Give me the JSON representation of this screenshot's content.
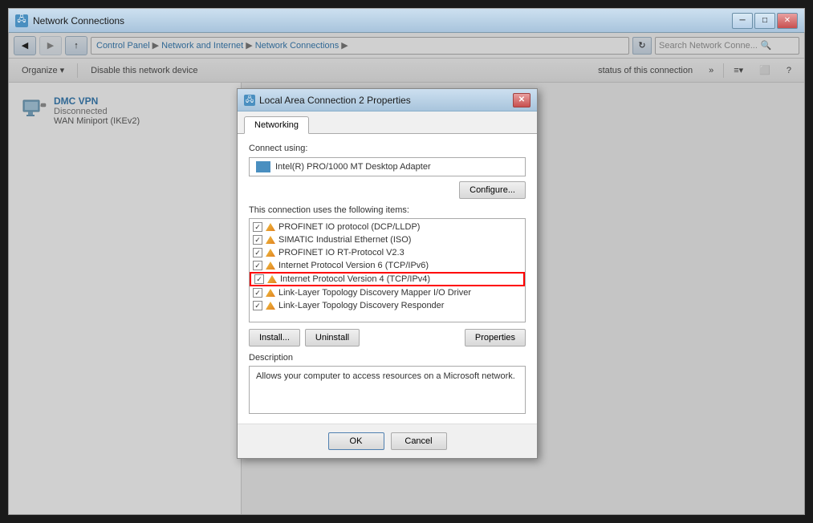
{
  "window": {
    "title": "Network Connections",
    "title_icon": "🖧"
  },
  "address_bar": {
    "crumbs": [
      "Control Panel",
      "Network and Internet",
      "Network Connections"
    ],
    "search_placeholder": "Search Network Conne...",
    "refresh_icon": "↻"
  },
  "toolbar": {
    "organize_label": "Organize",
    "disable_label": "Disable this network device",
    "status_label": "status of this connection",
    "more_label": "»"
  },
  "network_connections": [
    {
      "name": "DMC VPN",
      "status": "Disconnected",
      "type": "WAN Miniport (IKEv2)"
    }
  ],
  "title_bar_buttons": {
    "minimize": "─",
    "maximize": "□",
    "close": "✕"
  },
  "dialog": {
    "title": "Local Area Connection 2 Properties",
    "title_icon": "🖧",
    "tab_networking": "Networking",
    "connect_using_label": "Connect using:",
    "adapter_name": "Intel(R) PRO/1000 MT Desktop Adapter",
    "configure_btn": "Configure...",
    "items_label": "This connection uses the following items:",
    "items": [
      {
        "checked": true,
        "label": "PROFINET IO protocol (DCP/LLDP)"
      },
      {
        "checked": true,
        "label": "SIMATIC Industrial Ethernet (ISO)"
      },
      {
        "checked": true,
        "label": "PROFINET IO RT-Protocol V2.3"
      },
      {
        "checked": true,
        "label": "Internet Protocol Version 6 (TCP/IPv6)"
      },
      {
        "checked": true,
        "label": "Internet Protocol Version 4 (TCP/IPv4)",
        "highlighted": true
      },
      {
        "checked": true,
        "label": "Link-Layer Topology Discovery Mapper I/O Driver"
      },
      {
        "checked": true,
        "label": "Link-Layer Topology Discovery Responder"
      }
    ],
    "install_btn": "Install...",
    "uninstall_btn": "Uninstall",
    "properties_btn": "Properties",
    "description_label": "Description",
    "description_text": "Allows your computer to access resources on a Microsoft network.",
    "ok_btn": "OK",
    "cancel_btn": "Cancel"
  }
}
